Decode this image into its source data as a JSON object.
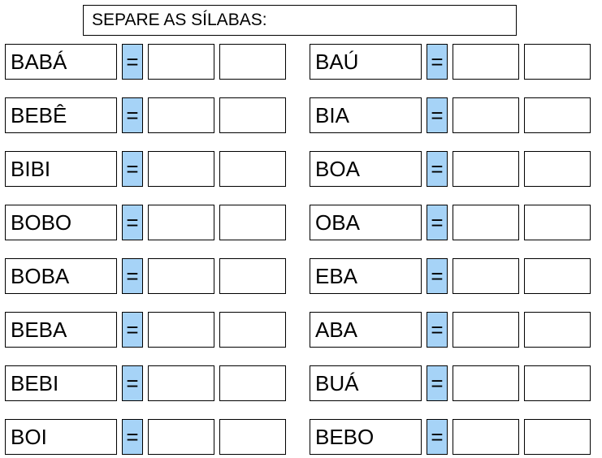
{
  "title": "SEPARE AS SÍLABAS:",
  "equals": "=",
  "left_column": [
    {
      "word": "BABÁ"
    },
    {
      "word": "BEBÊ"
    },
    {
      "word": "BIBI"
    },
    {
      "word": "BOBO"
    },
    {
      "word": "BOBA"
    },
    {
      "word": "BEBA"
    },
    {
      "word": "BEBI"
    },
    {
      "word": "BOI"
    }
  ],
  "right_column": [
    {
      "word": "BAÚ"
    },
    {
      "word": "BIA"
    },
    {
      "word": "BOA"
    },
    {
      "word": "OBA"
    },
    {
      "word": "EBA"
    },
    {
      "word": "ABA"
    },
    {
      "word": "BUÁ"
    },
    {
      "word": "BEBO"
    }
  ]
}
